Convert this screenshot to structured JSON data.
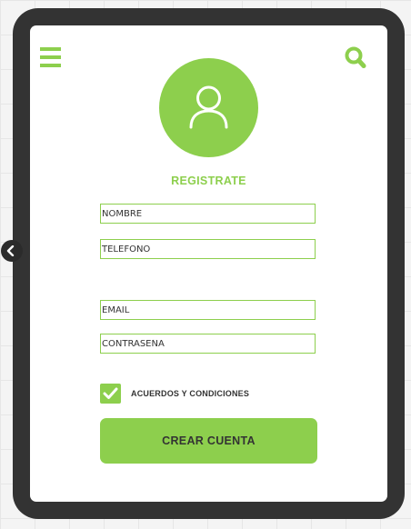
{
  "colors": {
    "accent": "#8dcf4d",
    "frame": "#333333",
    "screen": "#ffffff",
    "text": "#333333"
  },
  "header": {
    "menu_icon": "hamburger-menu-icon",
    "search_icon": "search-icon"
  },
  "avatar": {
    "icon": "user-icon"
  },
  "form": {
    "title": "REGISTRATE",
    "fields": {
      "name": {
        "placeholder": "NOMBRE"
      },
      "phone": {
        "placeholder": "TELEFONO"
      },
      "email": {
        "placeholder": "EMAIL"
      },
      "password": {
        "placeholder": "CONTRASEÑA"
      }
    },
    "terms": {
      "label": "ACUERDOS Y CONDICIONES",
      "checked": true
    },
    "submit_label": "CREAR CUENTA"
  }
}
